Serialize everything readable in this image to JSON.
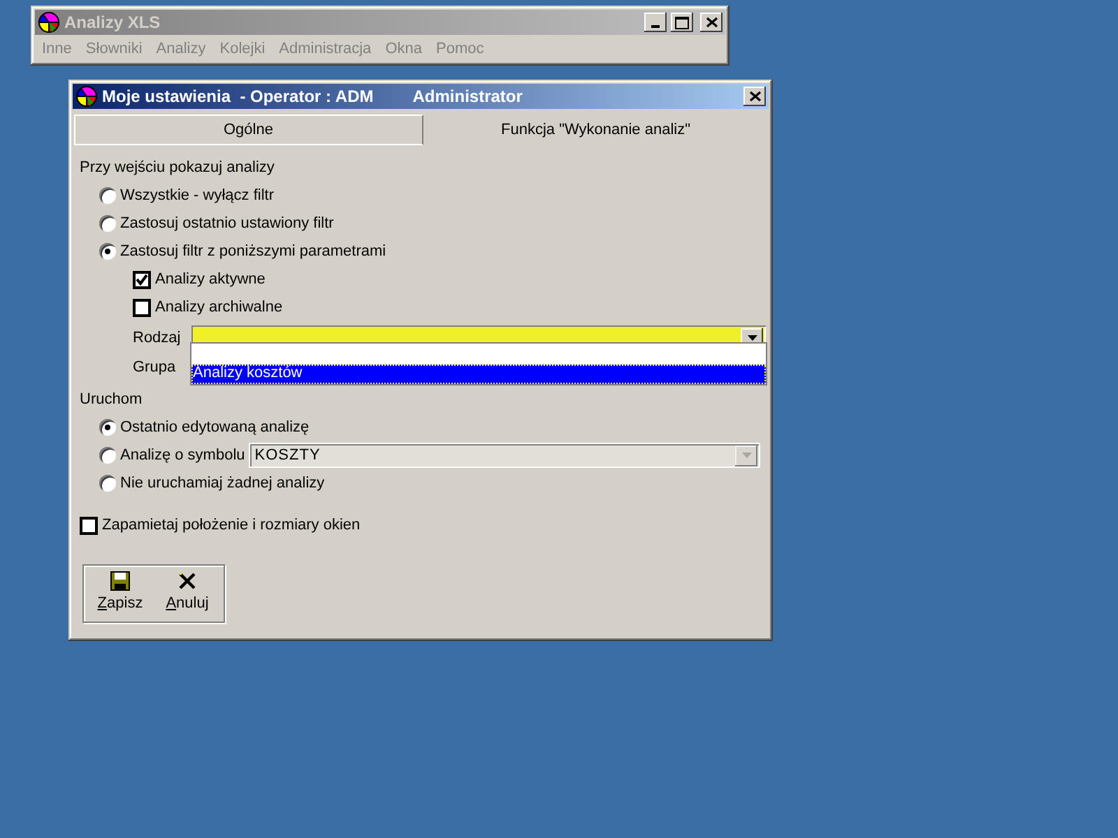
{
  "app_window": {
    "title": "Analizy XLS",
    "menu": [
      "Inne",
      "Słowniki",
      "Analizy",
      "Kolejki",
      "Administracja",
      "Okna",
      "Pomoc"
    ]
  },
  "dialog": {
    "title": "Moje ustawienia  - Operator : ADM",
    "user": "Administrator",
    "tabs": [
      {
        "label": "Ogólne",
        "selected": false
      },
      {
        "label": "Funkcja \"Wykonanie analiz\"",
        "selected": true
      }
    ],
    "filter_section": {
      "heading": "Przy wejściu pokazuj analizy",
      "options": [
        {
          "label": "Wszystkie - wyłącz filtr",
          "selected": false
        },
        {
          "label": "Zastosuj ostatnio ustawiony filtr",
          "selected": false
        },
        {
          "label": "Zastosuj filtr z poniższymi parametrami",
          "selected": true
        }
      ],
      "checks": [
        {
          "label": "Analizy aktywne",
          "checked": true
        },
        {
          "label": "Analizy archiwalne",
          "checked": false
        }
      ],
      "fields": [
        {
          "label": "Rodzaj"
        },
        {
          "label": "Grupa"
        }
      ],
      "dropdown_list": [
        {
          "label": "Analizy kosztów",
          "selected": true
        }
      ]
    },
    "run_section": {
      "heading": "Uruchom",
      "options": [
        {
          "kind": "plain",
          "label": "Ostatnio edytowaną analizę",
          "selected": true
        },
        {
          "kind": "with_field",
          "label": "Analizę o symbolu",
          "selected": false,
          "value": "KOSZTY"
        },
        {
          "kind": "plain",
          "label": "Nie uruchamiaj żadnej analizy",
          "selected": false
        }
      ]
    },
    "remember": {
      "label": "Zapamietaj położenie i rozmiary okien",
      "checked": false
    },
    "buttons": [
      {
        "kind": "save",
        "label": "Zapisz"
      },
      {
        "kind": "cancel",
        "label": "Anuluj"
      }
    ]
  }
}
